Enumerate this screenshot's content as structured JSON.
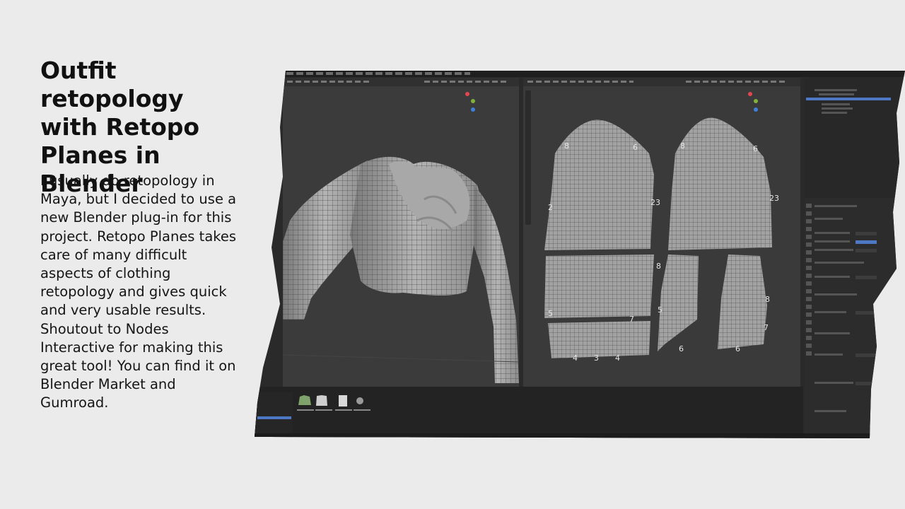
{
  "slide": {
    "title": "Outfit retopology\nwith Retopo\nPlanes in Blender",
    "body": "I usually do retopology in\nMaya, but I decided to use a\nnew Blender plug-in for this\nproject. Retopo Planes takes\ncare of many difficult\naspects of clothing\nretopology and gives quick\nand very usable results.\nShoutout to Nodes\nInteractive for making this\ngreat tool! You can find it on\nBlender Market and\nGumroad."
  },
  "screenshot": {
    "uv_labels": [
      "8",
      "6",
      "2",
      "23",
      "8",
      "6",
      "23",
      "5",
      "8",
      "7",
      "6",
      "4",
      "3",
      "5",
      "6",
      "8",
      "7",
      "4"
    ]
  },
  "colors": {
    "viewport_bg": "#3b3b3b",
    "mesh_fill": "#9a9a9a",
    "mesh_lines": "#4a4a4a",
    "selection_blue": "#4f78c4",
    "gizmo_red": "#e0474e",
    "gizmo_green": "#7fb23a",
    "gizmo_blue": "#3f7fd8"
  }
}
